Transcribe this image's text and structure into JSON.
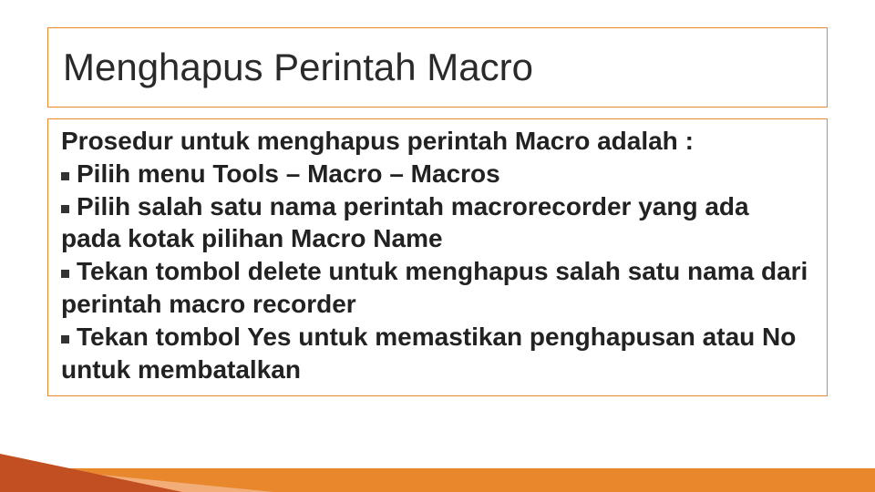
{
  "title": "Menghapus Perintah Macro",
  "intro": "Prosedur untuk menghapus perintah Macro adalah :",
  "items": [
    "Pilih menu Tools – Macro – Macros",
    "Pilih salah satu nama perintah macrorecorder yang ada pada kotak pilihan Macro Name",
    "Tekan tombol delete untuk menghapus salah satu nama dari perintah macro recorder",
    "Tekan tombol Yes untuk memastikan penghapusan atau No untuk membatalkan"
  ],
  "colors": {
    "accent": "#e8872b",
    "wedge_dark": "#c14f22",
    "wedge_light": "#f5b487"
  }
}
